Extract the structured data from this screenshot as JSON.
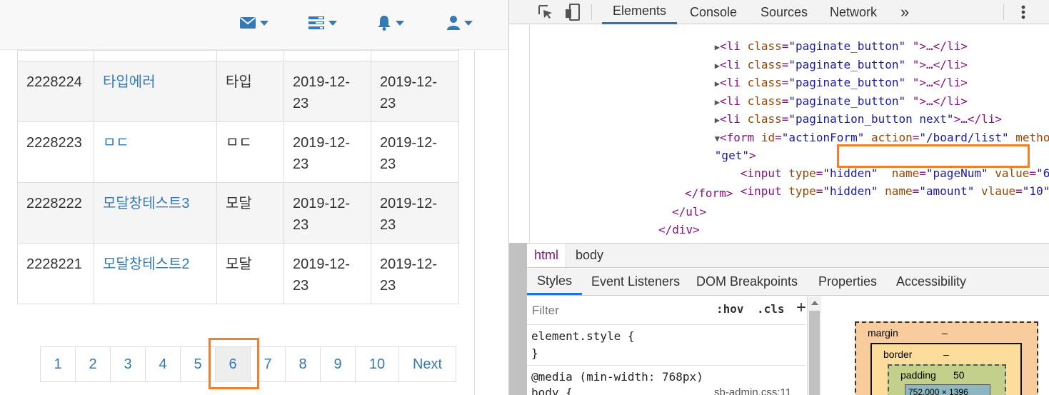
{
  "page": {
    "nav": {
      "icons": [
        "envelope-icon",
        "tasks-icon",
        "bell-icon",
        "user-icon"
      ],
      "accent": "#337ab7"
    },
    "table": {
      "rows": [
        {
          "id": "2228224",
          "title": "타입에러",
          "writer": "타입",
          "regdate": "2019-12-23",
          "updatedate": "2019-12-23"
        },
        {
          "id": "2228223",
          "title": "ㅁㄷ",
          "writer": "ㅁㄷ",
          "regdate": "2019-12-23",
          "updatedate": "2019-12-23"
        },
        {
          "id": "2228222",
          "title": "모달창테스트3",
          "writer": "모달",
          "regdate": "2019-12-23",
          "updatedate": "2019-12-23"
        },
        {
          "id": "2228221",
          "title": "모달창테스트2",
          "writer": "모달",
          "regdate": "2019-12-23",
          "updatedate": "2019-12-23"
        }
      ]
    },
    "pagination": {
      "pages": [
        "1",
        "2",
        "3",
        "4",
        "5",
        "6",
        "7",
        "8",
        "9",
        "10"
      ],
      "active": "6",
      "next_label": "Next"
    }
  },
  "devtools": {
    "tabs": {
      "elements": "Elements",
      "console": "Console",
      "sources": "Sources",
      "network": "Network",
      "more": "»"
    },
    "elements_lines": {
      "li1": {
        "tag_open": "<li ",
        "attr": "class",
        "eq": "=",
        "val": "\"paginate_button\"",
        "rest": " \">…</li>"
      },
      "li2": {
        "tag_open": "<li ",
        "attr": "class",
        "eq": "=",
        "val": "\"paginate_button\"",
        "rest": " \">…</li>"
      },
      "li3": {
        "tag_open": "<li ",
        "attr": "class",
        "eq": "=",
        "val": "\"paginate_button\"",
        "rest": " \">…</li>"
      },
      "li4": {
        "tag_open": "<li ",
        "attr": "class",
        "eq": "=",
        "val": "\"paginate_button\"",
        "rest": " \">…</li>"
      },
      "li5": {
        "tag_open": "<li ",
        "attr": "class",
        "eq": "=",
        "val": "\"pagination_button next\"",
        "rest": ">…</li>"
      },
      "form": {
        "tag_open": "<form ",
        "a1": "id",
        "v1": "\"actionForm\"",
        "a2": "action",
        "v2": "\"/board/list\"",
        "a3": "method",
        "eq": "="
      },
      "form_cont": {
        "val": "\"get\"",
        "close": ">"
      },
      "input1": {
        "tag_open": "<input ",
        "a1": "type",
        "v1": "\"hidden\"",
        "a2": "name",
        "v2": "\"pageNum\"",
        "a3": "value",
        "v3": "\"6\"",
        "close": ">"
      },
      "input2": {
        "tag_open": "<input ",
        "a1": "type",
        "v1": "\"hidden\"",
        "a2": "name",
        "v2": "\"amount\"",
        "a3": "vlaue",
        "v3": "\"10\"",
        "close": ">"
      },
      "form_close": "</form>",
      "ul_close": "</ul>",
      "div_close": "</div>"
    },
    "breadcrumb": [
      "html",
      "body"
    ],
    "subtabs": [
      "Styles",
      "Event Listeners",
      "DOM Breakpoints",
      "Properties",
      "Accessibility"
    ],
    "styles": {
      "filter_placeholder": "Filter",
      "hov": ":hov",
      "cls": ".cls",
      "add": "+",
      "element_style_open": "element.style {",
      "element_style_close": "}",
      "media": "@media (min-width: 768px)",
      "body_rule": "body {",
      "source": "sb-admin.css:11"
    },
    "boxmodel": {
      "margin_label": "margin",
      "margin_value": "–",
      "border_label": "border",
      "border_value": "–",
      "padding_label": "padding",
      "padding_value": "50",
      "content_value": "752.000 × 1396"
    }
  }
}
